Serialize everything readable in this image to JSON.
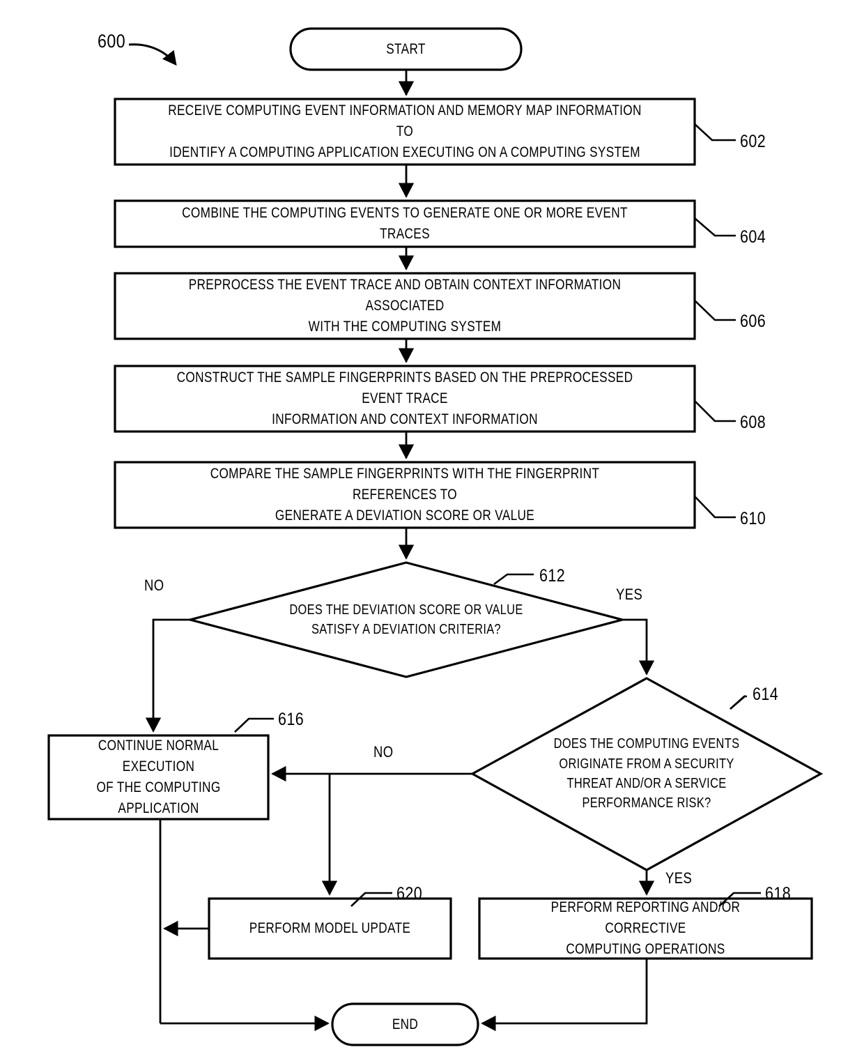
{
  "figure": {
    "number": "600"
  },
  "nodes": {
    "start": {
      "label": "START",
      "shape": "terminator"
    },
    "end": {
      "label": "END",
      "shape": "terminator"
    },
    "n602": {
      "ref": "602",
      "shape": "process",
      "lines": [
        "RECEIVE COMPUTING EVENT INFORMATION AND MEMORY MAP INFORMATION TO",
        "IDENTIFY A COMPUTING APPLICATION EXECUTING ON A COMPUTING SYSTEM"
      ]
    },
    "n604": {
      "ref": "604",
      "shape": "process",
      "lines": [
        "COMBINE THE COMPUTING EVENTS TO GENERATE ONE OR MORE EVENT TRACES"
      ]
    },
    "n606": {
      "ref": "606",
      "shape": "process",
      "lines": [
        "PREPROCESS THE EVENT TRACE AND OBTAIN CONTEXT INFORMATION ASSOCIATED",
        "WITH THE COMPUTING SYSTEM"
      ]
    },
    "n608": {
      "ref": "608",
      "shape": "process",
      "lines": [
        "CONSTRUCT THE SAMPLE FINGERPRINTS BASED ON THE PREPROCESSED EVENT TRACE",
        "INFORMATION AND CONTEXT INFORMATION"
      ]
    },
    "n610": {
      "ref": "610",
      "shape": "process",
      "lines": [
        "COMPARE THE SAMPLE FINGERPRINTS WITH THE FINGERPRINT REFERENCES TO",
        "GENERATE A DEVIATION SCORE OR VALUE"
      ]
    },
    "n612": {
      "ref": "612",
      "shape": "decision",
      "lines": [
        "DOES THE DEVIATION SCORE OR VALUE",
        "SATISFY A DEVIATION CRITERIA?"
      ],
      "branch_no": "NO",
      "branch_yes": "YES"
    },
    "n614": {
      "ref": "614",
      "shape": "decision",
      "lines": [
        "DOES THE COMPUTING EVENTS",
        "ORIGINATE FROM A SECURITY",
        "THREAT AND/OR A SERVICE",
        "PERFORMANCE RISK?"
      ],
      "branch_no": "NO",
      "branch_yes": "YES"
    },
    "n616": {
      "ref": "616",
      "shape": "process",
      "lines": [
        "CONTINUE NORMAL EXECUTION",
        "OF THE COMPUTING",
        "APPLICATION"
      ]
    },
    "n618": {
      "ref": "618",
      "shape": "process",
      "lines": [
        "PERFORM REPORTING AND/OR CORRECTIVE",
        "COMPUTING OPERATIONS"
      ]
    },
    "n620": {
      "ref": "620",
      "shape": "process",
      "lines": [
        "PERFORM MODEL UPDATE"
      ]
    }
  },
  "colors": {
    "stroke": "#000000",
    "fill": "#ffffff",
    "text": "#000000"
  }
}
